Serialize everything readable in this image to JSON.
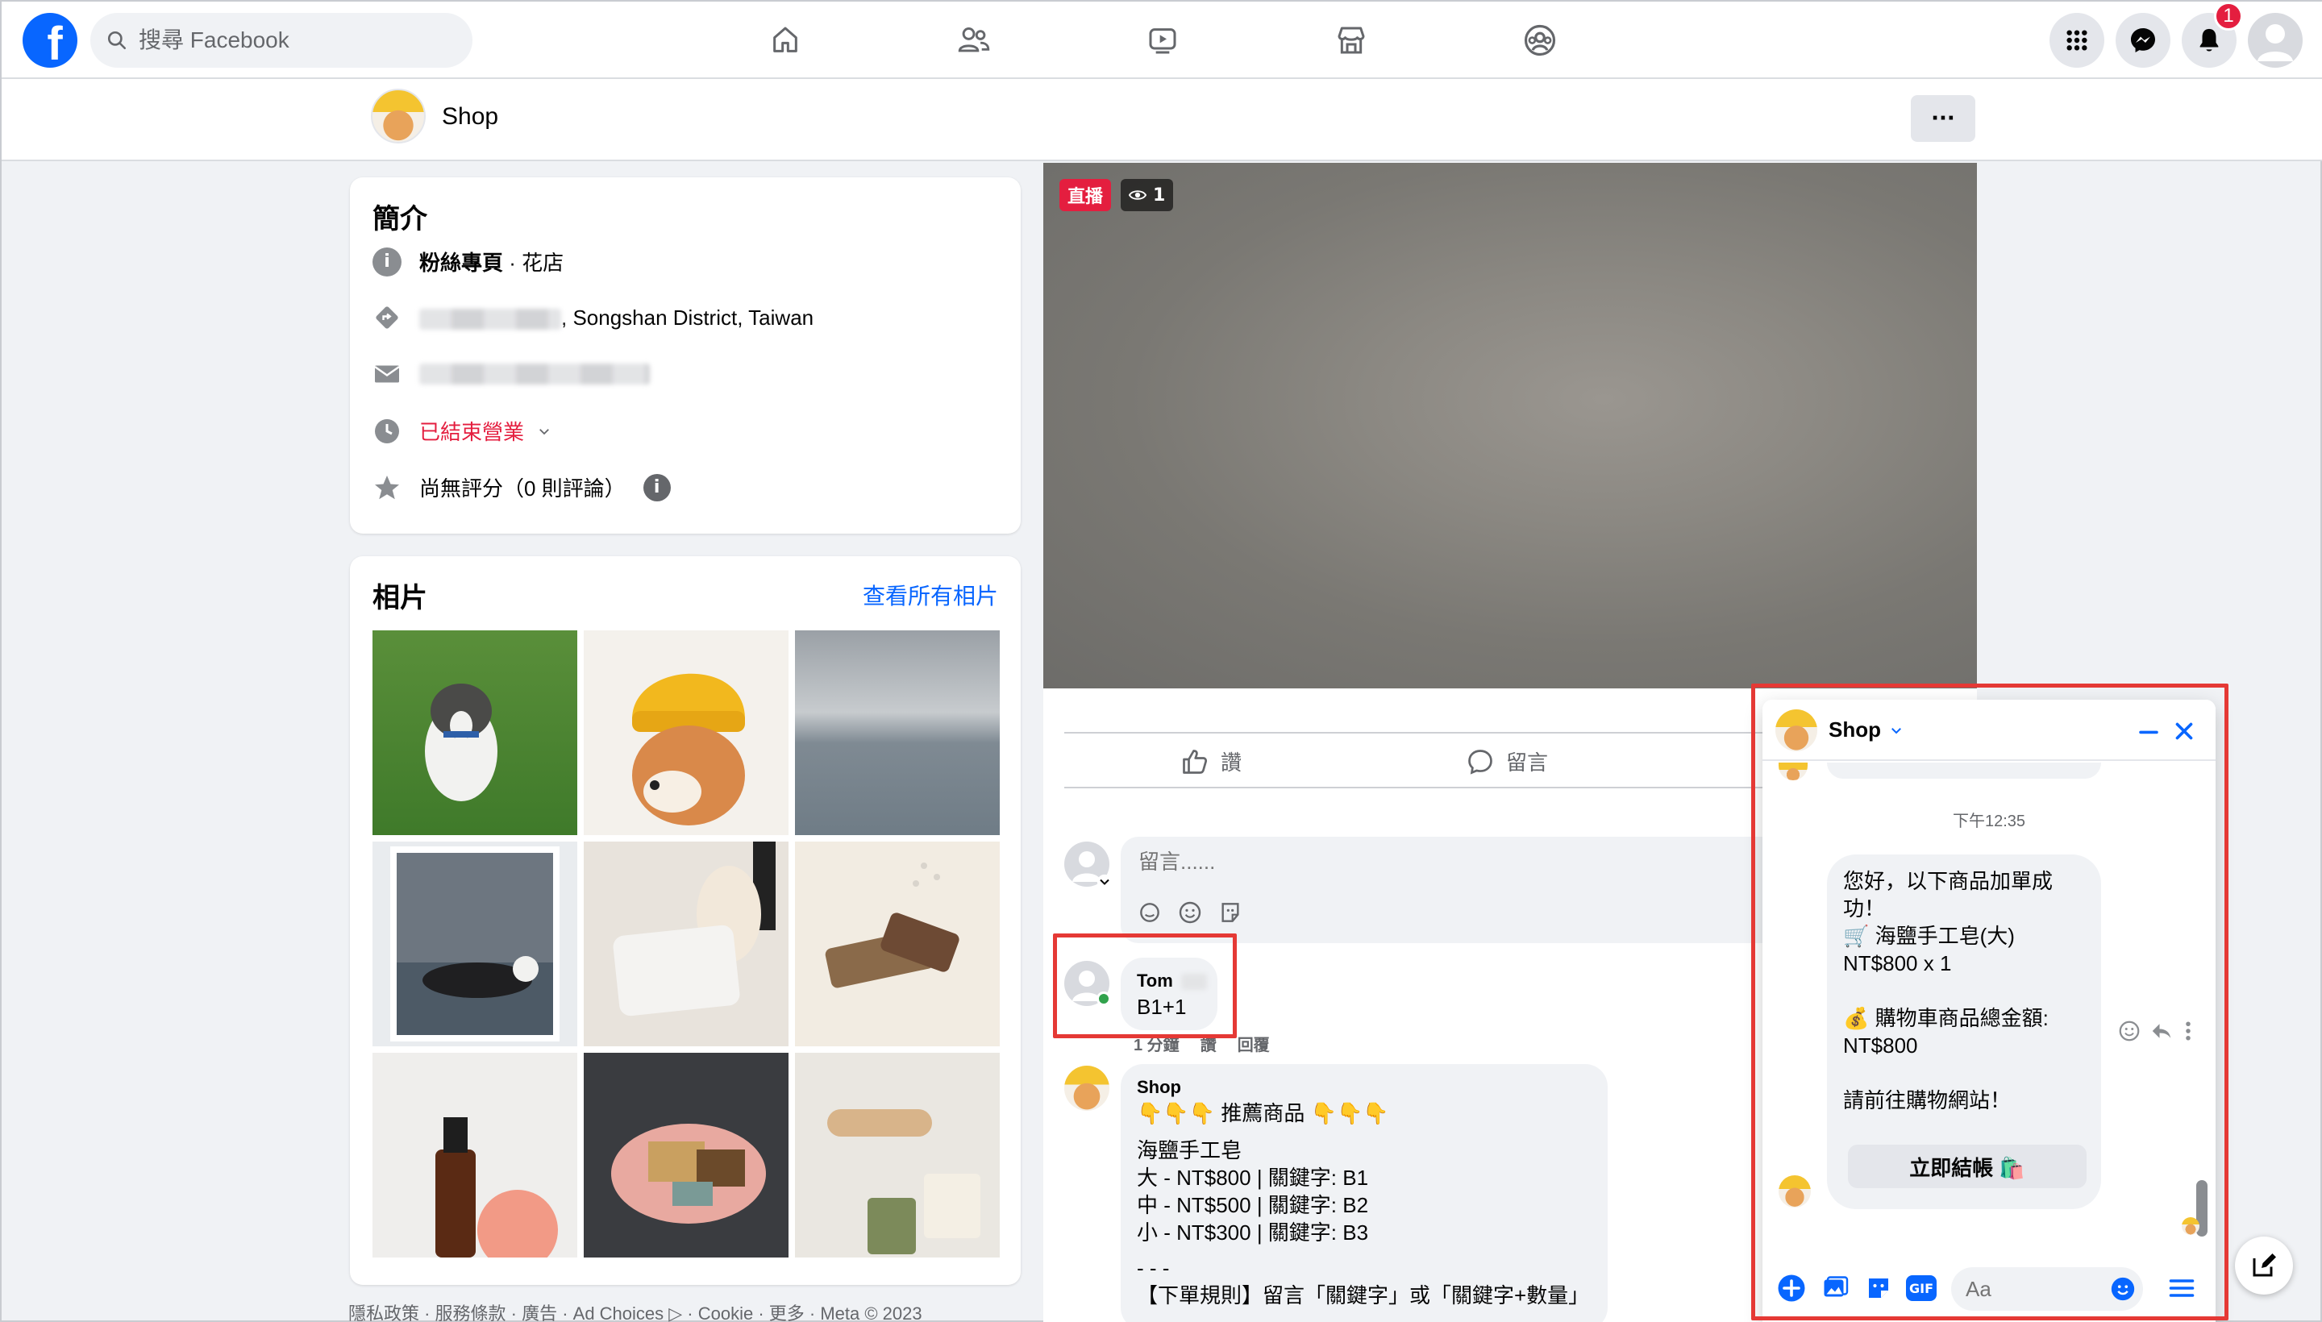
{
  "topbar": {
    "logo": "f",
    "search_placeholder": "搜尋 Facebook",
    "notification_count": "1",
    "icons": [
      "home-icon",
      "friends-icon",
      "video-icon",
      "marketplace-icon",
      "groups-icon",
      "menu-grid-icon",
      "messenger-icon",
      "bell-icon",
      "profile-avatar"
    ]
  },
  "page_header": {
    "name": "Shop",
    "more": "···"
  },
  "intro": {
    "title": "簡介",
    "category_bold": "粉絲專頁",
    "category_rest": " · 花店",
    "address": ", Songshan District, Taiwan",
    "status": "已結束營業",
    "rating": "尚無評分（0 則評論）"
  },
  "photos": {
    "title": "相片",
    "see_all": "查看所有相片"
  },
  "video": {
    "live": "直播",
    "viewers": "1"
  },
  "post_actions": {
    "like": "讚",
    "comment": "留言"
  },
  "comment_box": {
    "placeholder": "留言......"
  },
  "comments": [
    {
      "author": "Tom",
      "text": "B1+1",
      "meta_time": "1 分鐘",
      "meta_like": "讚",
      "meta_reply": "回覆"
    },
    {
      "author": "Shop",
      "lines": [
        "👇👇👇 推薦商品 👇👇👇",
        "",
        "海鹽手工皂",
        "大 - NT$800 | 關鍵字: B1",
        "中 - NT$500 | 關鍵字: B2",
        "小 - NT$300 | 關鍵字: B3",
        "",
        "- - -",
        "【下單規則】留言「關鍵字」或「關鍵字+數量」"
      ]
    }
  ],
  "chat": {
    "name": "Shop",
    "time": "下午12:35",
    "message_lines": [
      "您好，以下商品加單成",
      "功！",
      "🛒 海鹽手工皂(大)",
      "NT$800 x 1",
      "",
      "💰 購物車商品總金額:",
      "NT$800",
      "",
      "請前往購物網站！"
    ],
    "checkout_button": "立即結帳 🛍️",
    "input_placeholder": "Aa",
    "gif_label": "GIF"
  },
  "footer": "隱私政策 · 服務條款 · 廣告 · Ad Choices ▷ · Cookie · 更多 · Meta © 2023",
  "colors": {
    "brand_blue": "#0866ff",
    "status_red": "#e41e3f",
    "highlight_red": "#e53935",
    "bg_gray": "#f0f2f5"
  }
}
